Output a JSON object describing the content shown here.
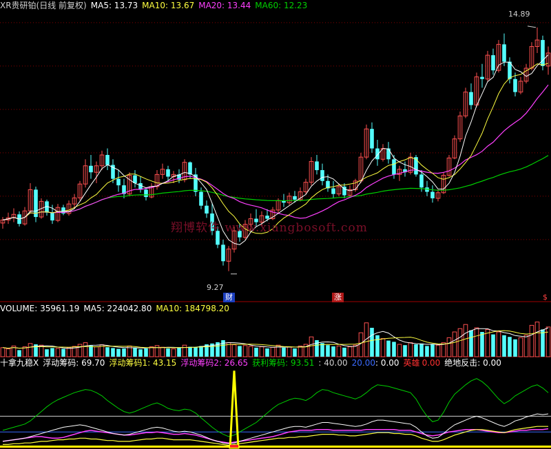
{
  "header_price": {
    "title": "XR贵研铂(日线 前复权)",
    "ma5": "MA5: 13.73",
    "ma10": "MA10: 13.67",
    "ma20": "MA20: 13.44",
    "ma60": "MA60: 12.23"
  },
  "header_volume": {
    "volume": "VOLUME: 35961.19",
    "ma5": "MA5: 224042.80",
    "ma10": "MA10: 184798.20"
  },
  "header_indicator": {
    "name": "十拿九稳X",
    "f1": "浮动筹码: 69.70",
    "f2": "浮动筹码1: 43.15",
    "f3": "浮动筹码2: 26.65",
    "profit": "获利筹码: 93.51",
    "forty": ": 40.00",
    "twenty_label": "20.00",
    "twenty_val": ": 0.00",
    "hero_label": "英雄",
    "hero_val": "0.00",
    "rebound": "绝地反击: 0.00"
  },
  "annotations": {
    "high": "14.89",
    "low": "9.27",
    "cai": "财",
    "zhang": "涨",
    "dollar": "$"
  },
  "watermark": "翔博软件 www.xiangbosoft.com",
  "colors": {
    "up": "#ff5050",
    "down": "#54ffff",
    "ma5": "#ffffff",
    "ma10": "#ffff40",
    "ma20": "#ff40ff",
    "ma60": "#00d000",
    "grid": "#8b0000"
  },
  "chart_data": {
    "type": "candlestick",
    "price_range": [
      8.6,
      15.3
    ],
    "candles": [
      [
        10.38,
        10.52,
        10.25,
        10.45
      ],
      [
        10.45,
        10.62,
        10.36,
        10.5
      ],
      [
        10.5,
        10.72,
        10.4,
        10.58
      ],
      [
        10.58,
        10.65,
        10.3,
        10.36
      ],
      [
        10.36,
        10.75,
        10.32,
        10.66
      ],
      [
        10.66,
        11.3,
        10.6,
        11.15
      ],
      [
        11.15,
        11.22,
        10.4,
        10.52
      ],
      [
        10.52,
        10.95,
        10.48,
        10.88
      ],
      [
        10.88,
        10.92,
        10.55,
        10.62
      ],
      [
        10.62,
        10.8,
        10.36,
        10.44
      ],
      [
        10.44,
        10.82,
        10.4,
        10.74
      ],
      [
        10.74,
        10.8,
        10.56,
        10.6
      ],
      [
        10.6,
        10.9,
        10.55,
        10.82
      ],
      [
        10.82,
        11.05,
        10.7,
        10.96
      ],
      [
        10.96,
        11.35,
        10.9,
        11.28
      ],
      [
        11.28,
        11.85,
        11.2,
        11.7
      ],
      [
        11.7,
        11.95,
        11.4,
        11.55
      ],
      [
        11.55,
        11.8,
        11.3,
        11.7
      ],
      [
        11.7,
        12.05,
        11.6,
        11.95
      ],
      [
        11.95,
        12.1,
        11.6,
        11.72
      ],
      [
        11.72,
        11.85,
        11.3,
        11.4
      ],
      [
        11.4,
        11.6,
        11.1,
        11.25
      ],
      [
        11.25,
        11.4,
        10.95,
        11.05
      ],
      [
        11.05,
        11.55,
        11.0,
        11.48
      ],
      [
        11.48,
        11.6,
        11.2,
        11.3
      ],
      [
        11.3,
        11.45,
        11.08,
        11.15
      ],
      [
        11.15,
        11.2,
        10.9,
        10.98
      ],
      [
        10.98,
        11.3,
        10.95,
        11.22
      ],
      [
        11.22,
        11.6,
        11.15,
        11.5
      ],
      [
        11.5,
        11.75,
        11.4,
        11.62
      ],
      [
        11.62,
        11.7,
        11.35,
        11.45
      ],
      [
        11.45,
        11.58,
        11.3,
        11.5
      ],
      [
        11.5,
        11.62,
        11.3,
        11.38
      ],
      [
        11.38,
        11.85,
        11.32,
        11.78
      ],
      [
        11.78,
        11.8,
        11.4,
        11.5
      ],
      [
        11.5,
        11.65,
        11.0,
        11.1
      ],
      [
        11.1,
        11.2,
        10.7,
        10.78
      ],
      [
        10.78,
        10.9,
        10.5,
        10.6
      ],
      [
        10.6,
        10.85,
        10.1,
        10.2
      ],
      [
        10.2,
        10.3,
        9.8,
        9.88
      ],
      [
        9.88,
        10.0,
        9.4,
        9.5
      ],
      [
        9.5,
        9.85,
        9.27,
        9.78
      ],
      [
        9.78,
        10.3,
        9.7,
        10.2
      ],
      [
        10.2,
        10.35,
        9.95,
        10.05
      ],
      [
        10.05,
        10.45,
        10.0,
        10.35
      ],
      [
        10.35,
        10.6,
        10.2,
        10.48
      ],
      [
        10.48,
        10.7,
        10.3,
        10.4
      ],
      [
        10.4,
        10.65,
        10.3,
        10.55
      ],
      [
        10.55,
        10.7,
        10.42,
        10.48
      ],
      [
        10.48,
        10.75,
        10.45,
        10.68
      ],
      [
        10.68,
        10.95,
        10.6,
        10.9
      ],
      [
        10.9,
        11.05,
        10.75,
        10.85
      ],
      [
        10.85,
        11.08,
        10.8,
        11.0
      ],
      [
        11.0,
        11.12,
        10.85,
        10.92
      ],
      [
        10.92,
        11.2,
        10.88,
        11.1
      ],
      [
        11.1,
        11.4,
        11.05,
        11.32
      ],
      [
        11.32,
        11.9,
        11.25,
        11.8
      ],
      [
        11.8,
        11.95,
        11.5,
        11.6
      ],
      [
        11.6,
        11.75,
        11.25,
        11.35
      ],
      [
        11.35,
        11.5,
        11.1,
        11.18
      ],
      [
        11.18,
        11.35,
        10.95,
        11.05
      ],
      [
        11.05,
        11.3,
        11.0,
        11.22
      ],
      [
        11.22,
        11.3,
        10.95,
        11.02
      ],
      [
        11.02,
        11.25,
        10.98,
        11.15
      ],
      [
        11.15,
        11.4,
        11.1,
        11.35
      ],
      [
        11.35,
        12.0,
        11.3,
        11.9
      ],
      [
        11.9,
        12.65,
        11.85,
        12.55
      ],
      [
        12.55,
        12.7,
        12.0,
        12.1
      ],
      [
        12.1,
        12.3,
        11.7,
        11.85
      ],
      [
        11.85,
        12.2,
        11.8,
        12.1
      ],
      [
        12.1,
        12.25,
        11.75,
        11.85
      ],
      [
        11.85,
        11.95,
        11.4,
        11.5
      ],
      [
        11.5,
        11.7,
        11.35,
        11.62
      ],
      [
        11.62,
        11.8,
        11.45,
        11.55
      ],
      [
        11.55,
        12.0,
        11.5,
        11.9
      ],
      [
        11.9,
        11.95,
        11.45,
        11.5
      ],
      [
        11.5,
        11.6,
        11.1,
        11.2
      ],
      [
        11.2,
        11.35,
        11.0,
        11.1
      ],
      [
        11.1,
        11.25,
        10.85,
        10.95
      ],
      [
        10.95,
        11.15,
        10.88,
        11.08
      ],
      [
        11.08,
        11.55,
        11.05,
        11.48
      ],
      [
        11.48,
        11.95,
        11.45,
        11.88
      ],
      [
        11.88,
        12.4,
        11.85,
        12.32
      ],
      [
        12.32,
        12.95,
        12.25,
        12.85
      ],
      [
        12.85,
        13.5,
        12.8,
        13.4
      ],
      [
        13.4,
        13.6,
        13.0,
        13.1
      ],
      [
        13.1,
        13.85,
        13.05,
        13.75
      ],
      [
        13.75,
        14.05,
        13.5,
        13.7
      ],
      [
        13.7,
        14.35,
        13.65,
        14.25
      ],
      [
        14.25,
        14.4,
        13.8,
        13.9
      ],
      [
        13.9,
        14.6,
        13.85,
        14.5
      ],
      [
        14.5,
        14.75,
        14.0,
        14.1
      ],
      [
        14.1,
        14.2,
        13.6,
        13.7
      ],
      [
        13.7,
        13.85,
        13.3,
        13.4
      ],
      [
        13.4,
        13.75,
        13.35,
        13.65
      ],
      [
        13.65,
        14.05,
        13.6,
        13.95
      ],
      [
        13.95,
        14.55,
        13.9,
        14.45
      ],
      [
        14.45,
        14.89,
        14.3,
        14.6
      ],
      [
        14.6,
        14.7,
        13.9,
        14.0
      ],
      [
        14.0,
        14.45,
        13.8,
        14.3
      ]
    ],
    "volume_range": [
      0,
      500000
    ],
    "volume": [
      110000,
      95000,
      130000,
      80000,
      120000,
      160000,
      150000,
      140000,
      90000,
      105000,
      100000,
      95000,
      110000,
      125000,
      150000,
      170000,
      135000,
      120000,
      145000,
      115000,
      105000,
      95000,
      100000,
      130000,
      110000,
      90000,
      100000,
      120000,
      135000,
      115000,
      100000,
      95000,
      110000,
      140000,
      120000,
      115000,
      130000,
      150000,
      160000,
      175000,
      200000,
      170000,
      145000,
      130000,
      135000,
      125000,
      110000,
      120000,
      100000,
      115000,
      140000,
      110000,
      120000,
      100000,
      130000,
      150000,
      240000,
      200000,
      165000,
      140000,
      125000,
      130000,
      110000,
      120000,
      140000,
      290000,
      410000,
      350000,
      260000,
      220000,
      195000,
      180000,
      150000,
      140000,
      170000,
      150000,
      160000,
      130000,
      150000,
      140000,
      170000,
      230000,
      300000,
      340000,
      390000,
      320000,
      350000,
      300000,
      330000,
      270000,
      300000,
      260000,
      240000,
      210000,
      230000,
      260000,
      380000,
      420000,
      330000,
      360000
    ],
    "indicator_range": [
      0,
      100
    ],
    "floating": [
      22,
      24,
      26,
      28,
      30,
      34,
      40,
      46,
      52,
      57,
      61,
      64,
      67,
      70,
      72,
      74,
      73,
      70,
      66,
      60,
      55,
      50,
      46,
      44,
      46,
      49,
      52,
      55,
      57,
      54,
      50,
      48,
      47,
      49,
      48,
      44,
      38,
      32,
      26,
      21,
      17,
      14,
      16,
      20,
      24,
      28,
      32,
      38,
      44,
      50,
      55,
      58,
      61,
      63,
      62,
      60,
      64,
      70,
      74,
      73,
      70,
      68,
      66,
      64,
      62,
      65,
      70,
      76,
      80,
      79,
      78,
      76,
      74,
      72,
      70,
      62,
      50,
      40,
      33,
      35,
      45,
      58,
      68,
      74,
      80,
      85,
      88,
      84,
      78,
      70,
      62,
      56,
      60,
      66,
      70,
      74,
      78,
      80,
      76,
      70
    ],
    "floating1": [
      8,
      9,
      10,
      11,
      12,
      14,
      16,
      18,
      20,
      22,
      24,
      26,
      27,
      28,
      29,
      28,
      26,
      24,
      22,
      20,
      18,
      17,
      16,
      17,
      19,
      21,
      23,
      25,
      26,
      25,
      23,
      21,
      20,
      21,
      20,
      18,
      16,
      13,
      10,
      8,
      6,
      5,
      6,
      8,
      10,
      12,
      14,
      16,
      18,
      20,
      22,
      24,
      26,
      27,
      27,
      26,
      28,
      30,
      32,
      32,
      31,
      30,
      29,
      28,
      27,
      28,
      30,
      33,
      35,
      35,
      34,
      33,
      32,
      31,
      30,
      26,
      20,
      15,
      12,
      13,
      18,
      24,
      29,
      32,
      35,
      38,
      40,
      38,
      35,
      32,
      29,
      27,
      30,
      34,
      36,
      39,
      41,
      43,
      42,
      43
    ],
    "floating2": [
      4,
      4,
      5,
      5,
      6,
      6,
      7,
      8,
      8,
      9,
      10,
      10,
      11,
      11,
      12,
      12,
      11,
      11,
      10,
      9,
      9,
      8,
      8,
      8,
      9,
      10,
      11,
      11,
      12,
      12,
      11,
      10,
      10,
      10,
      10,
      9,
      8,
      7,
      6,
      5,
      4,
      3,
      4,
      5,
      6,
      7,
      8,
      9,
      10,
      11,
      12,
      12,
      13,
      13,
      14,
      14,
      15,
      16,
      17,
      17,
      17,
      16,
      16,
      15,
      15,
      16,
      17,
      18,
      19,
      19,
      19,
      18,
      18,
      17,
      17,
      15,
      12,
      10,
      8,
      8,
      10,
      13,
      16,
      18,
      20,
      22,
      23,
      23,
      22,
      21,
      20,
      19,
      21,
      23,
      24,
      25,
      26,
      27,
      27,
      27
    ],
    "profit": [
      8,
      9,
      10,
      11,
      12,
      13,
      14,
      14,
      13,
      12,
      12,
      13,
      15,
      17,
      19,
      21,
      22,
      21,
      20,
      19,
      18,
      17,
      16,
      16,
      17,
      18,
      19,
      19,
      20,
      19,
      18,
      17,
      17,
      18,
      17,
      16,
      14,
      12,
      10,
      8,
      7,
      6,
      7,
      8,
      9,
      10,
      11,
      12,
      13,
      14,
      16,
      18,
      20,
      21,
      22,
      22,
      22,
      23,
      23,
      23,
      22,
      22,
      22,
      22,
      22,
      22,
      23,
      23,
      23,
      23,
      23,
      23,
      22,
      22,
      22,
      20,
      18,
      16,
      15,
      16,
      18,
      20,
      21,
      22,
      23,
      23,
      23,
      22,
      21,
      20,
      19,
      19,
      20,
      21,
      22,
      22,
      23,
      23,
      23,
      24
    ],
    "spike": {
      "index": 42,
      "value": 98
    },
    "level_40": 40,
    "level_20": 20
  }
}
